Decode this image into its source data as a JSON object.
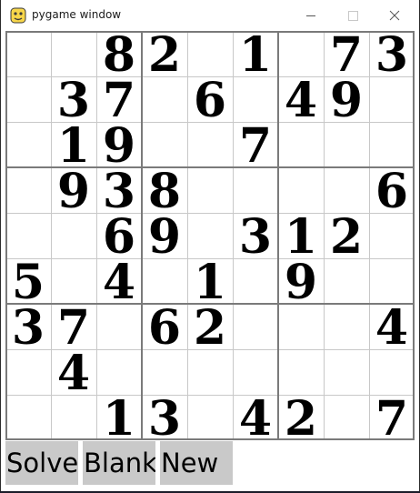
{
  "window": {
    "title": "pygame window",
    "controls": {
      "minimize_icon": "minimize-icon",
      "maximize_icon": "maximize-icon",
      "close_icon": "close-icon"
    },
    "app_icon": "pygame-snake-icon"
  },
  "board": {
    "rows": [
      [
        "",
        "",
        "8",
        "2",
        "",
        "1",
        "",
        "7",
        "3"
      ],
      [
        "",
        "3",
        "7",
        "",
        "6",
        "",
        "4",
        "9",
        ""
      ],
      [
        "",
        "1",
        "9",
        "",
        "",
        "7",
        "",
        "",
        ""
      ],
      [
        "",
        "9",
        "3",
        "8",
        "",
        "",
        "",
        "",
        "6"
      ],
      [
        "",
        "",
        "6",
        "9",
        "",
        "3",
        "1",
        "2",
        ""
      ],
      [
        "5",
        "",
        "4",
        "",
        "1",
        "",
        "9",
        "",
        ""
      ],
      [
        "3",
        "7",
        "",
        "6",
        "2",
        "",
        "",
        "",
        "4"
      ],
      [
        "",
        "4",
        "",
        "",
        "",
        "",
        "",
        "",
        ""
      ],
      [
        "",
        "",
        "1",
        "3",
        "",
        "4",
        "2",
        "",
        "7"
      ]
    ],
    "colors": {
      "thin_line": "#c8c8c8",
      "thick_line": "#7a7a7a",
      "digit": "#000000"
    }
  },
  "buttons": {
    "solve_label": "Solve",
    "blank_label": "Blank",
    "new_label": "New",
    "color": "#c9c9c9"
  }
}
